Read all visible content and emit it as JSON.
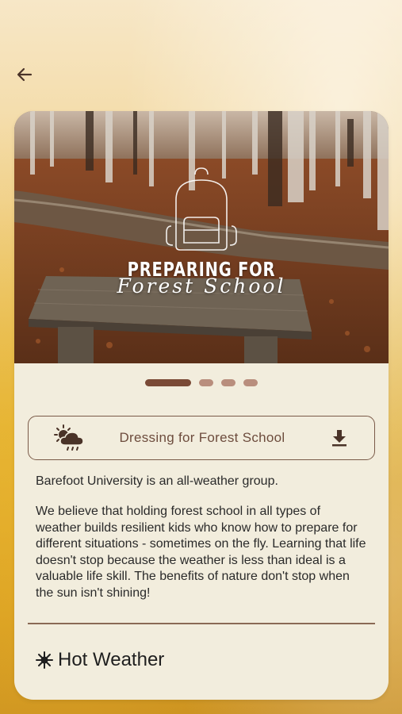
{
  "nav": {
    "back_icon": "arrow-left-icon"
  },
  "hero": {
    "title_line1": "PREPARING FOR",
    "title_line2": "Forest School",
    "background_icon": "backpack-icon"
  },
  "carousel": {
    "total": 4,
    "active_index": 0
  },
  "download": {
    "title": "Dressing for Forest School",
    "leading_icon": "sun-cloud-rain-icon",
    "trailing_icon": "download-icon"
  },
  "content": {
    "paragraph1": "Barefoot University is an all-weather group.",
    "paragraph2": "We believe that holding forest school in all types of weather builds resilient kids who know how to prepare for different situations - sometimes on the fly. Learning that life doesn't stop because the weather is less than ideal is a valuable life skill. The benefits of nature don't stop when the sun isn't shining!",
    "section_heading": "Hot Weather",
    "section_icon": "sun-icon"
  },
  "colors": {
    "card_bg": "#f2eddd",
    "accent_brown": "#7a4a36",
    "text_brown": "#6d4c3d",
    "dot_inactive": "#b98e7d"
  }
}
